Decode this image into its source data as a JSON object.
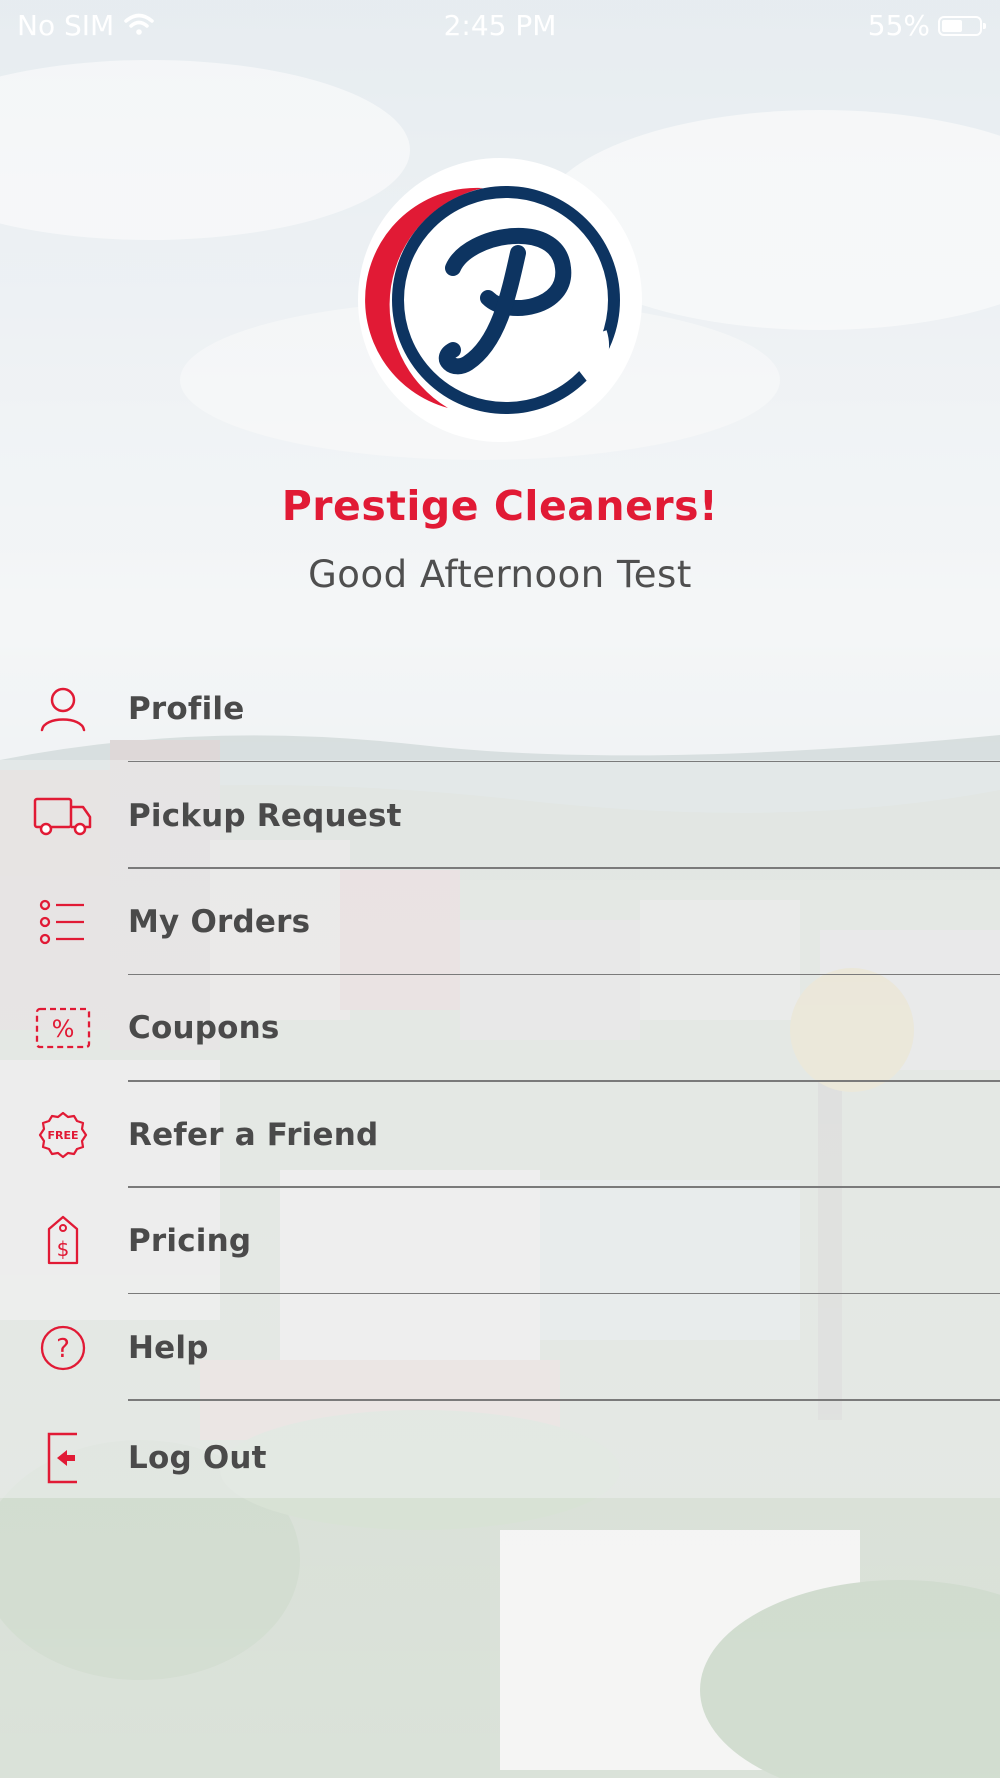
{
  "status_bar": {
    "carrier": "No SIM",
    "time": "2:45 PM",
    "battery_percent": "55%",
    "battery_level": 0.55
  },
  "brand": {
    "name": "Prestige Cleaners!",
    "greeting": "Good Afternoon Test",
    "logo_letter": "P"
  },
  "menu": {
    "items": [
      {
        "label": "Profile",
        "icon": "person-icon"
      },
      {
        "label": "Pickup Request",
        "icon": "truck-icon"
      },
      {
        "label": "My Orders",
        "icon": "list-icon"
      },
      {
        "label": "Coupons",
        "icon": "percent-coupon-icon"
      },
      {
        "label": "Refer a Friend",
        "icon": "free-badge-icon"
      },
      {
        "label": "Pricing",
        "icon": "price-tag-icon"
      },
      {
        "label": "Help",
        "icon": "question-icon"
      },
      {
        "label": "Log Out",
        "icon": "logout-icon"
      }
    ]
  },
  "icons": {
    "free_badge_text": "FREE",
    "coupon_symbol": "%",
    "price_symbol": "$",
    "help_symbol": "?"
  },
  "colors": {
    "accent_red": "#e11a35",
    "logo_navy": "#0d3461",
    "text_dark": "#4a4a4a"
  }
}
